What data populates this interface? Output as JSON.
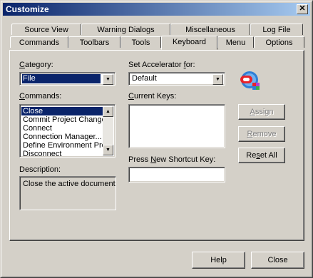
{
  "window": {
    "title": "Customize",
    "close_glyph": "✕"
  },
  "tabs": {
    "row1": [
      "Source View",
      "Warning Dialogs",
      "Miscellaneous",
      "Log File"
    ],
    "row2": [
      "Commands",
      "Toolbars",
      "Tools",
      "Keyboard",
      "Menu",
      "Options"
    ],
    "active": "Keyboard"
  },
  "category": {
    "label_u": "C",
    "label_rest": "ategory:",
    "value": "File"
  },
  "commands": {
    "label_u": "C",
    "label_rest": "ommands:",
    "items": [
      "Close",
      "Commit Project Changes",
      "Connect",
      "Connection Manager...",
      "Define Environment Prop",
      "Disconnect"
    ],
    "selected_index": 0
  },
  "description": {
    "label": "Description:",
    "text": "Close the active document"
  },
  "accelerator": {
    "label_pre": "Set Accelerator ",
    "label_u": "f",
    "label_post": "or:",
    "value": "Default"
  },
  "current_keys": {
    "label_u": "C",
    "label_rest": "urrent Keys:"
  },
  "shortcut": {
    "label_pre": "Press ",
    "label_u": "N",
    "label_post": "ew Shortcut Key:",
    "value": ""
  },
  "buttons": {
    "assign_u": "A",
    "assign_rest": "ssign",
    "remove_u": "R",
    "remove_rest": "emove",
    "reset_pre": "Re",
    "reset_u": "s",
    "reset_post": "et All",
    "help": "Help",
    "close": "Close"
  },
  "icons": {
    "app_logo": "oracle-ide-logo-icon",
    "scroll_up": "▲",
    "scroll_down": "▼",
    "combo_arrow": "▼"
  },
  "colors": {
    "selection": "#0a246a",
    "face": "#d4d0c8",
    "logo_red": "#e8232a",
    "logo_blue": "#2e7fd6"
  }
}
